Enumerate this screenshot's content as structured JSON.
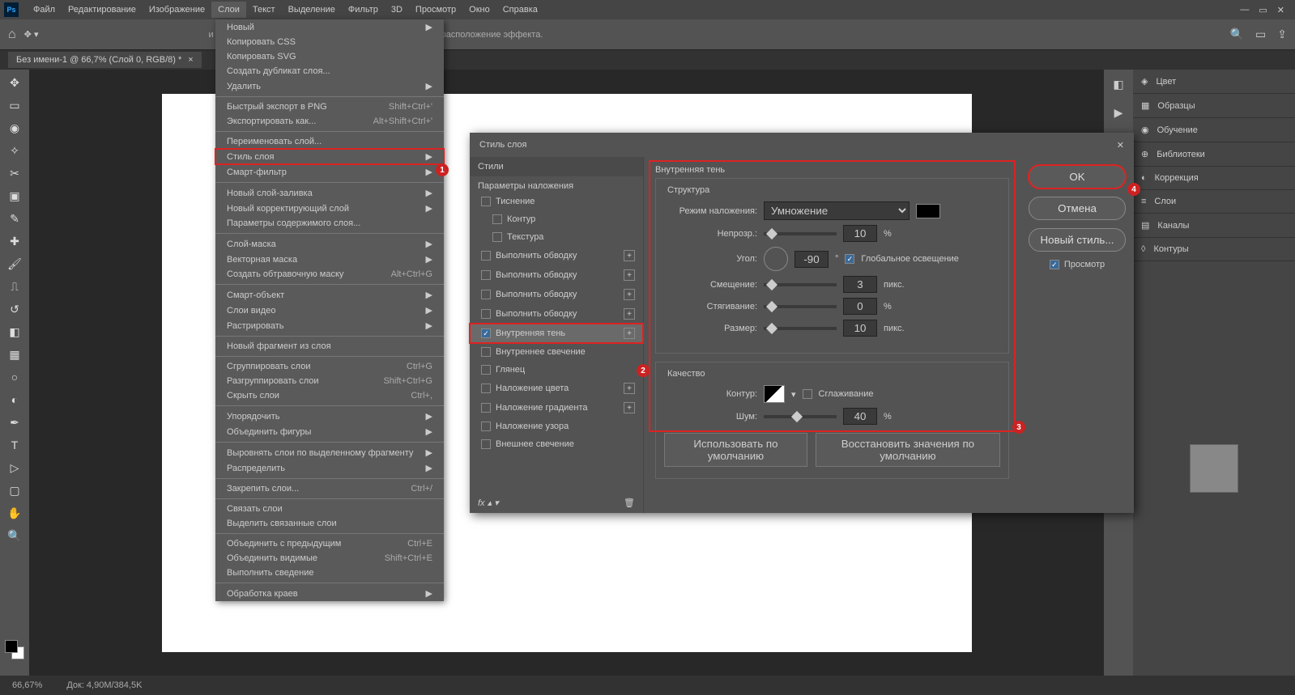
{
  "menubar": {
    "items": [
      "Файл",
      "Редактирование",
      "Изображение",
      "Слои",
      "Текст",
      "Выделение",
      "Фильтр",
      "3D",
      "Просмотр",
      "Окно",
      "Справка"
    ],
    "active_index": 3
  },
  "optionsbar": {
    "hint_tail": "и перетаскивайте ее указатель, чтобы скорректировать расположение эффекта."
  },
  "doc_tab": {
    "title": "Без имени-1 @ 66,7% (Слой 0, RGB/8) *"
  },
  "dropdown": {
    "groups": [
      [
        {
          "l": "Новый",
          "a": "▶"
        },
        {
          "l": "Копировать CSS"
        },
        {
          "l": "Копировать SVG"
        },
        {
          "l": "Создать дубликат слоя..."
        },
        {
          "l": "Удалить",
          "a": "▶"
        }
      ],
      [
        {
          "l": "Быстрый экспорт в PNG",
          "s": "Shift+Ctrl+'"
        },
        {
          "l": "Экспортировать как...",
          "s": "Alt+Shift+Ctrl+'"
        }
      ],
      [
        {
          "l": "Переименовать слой..."
        },
        {
          "l": "Стиль слоя",
          "a": "▶",
          "hl": true
        },
        {
          "l": "Смарт-фильтр",
          "a": "▶"
        }
      ],
      [
        {
          "l": "Новый слой-заливка",
          "a": "▶"
        },
        {
          "l": "Новый корректирующий слой",
          "a": "▶"
        },
        {
          "l": "Параметры содержимого слоя..."
        }
      ],
      [
        {
          "l": "Слой-маска",
          "a": "▶"
        },
        {
          "l": "Векторная маска",
          "a": "▶"
        },
        {
          "l": "Создать обтравочную маску",
          "s": "Alt+Ctrl+G"
        }
      ],
      [
        {
          "l": "Смарт-объект",
          "a": "▶"
        },
        {
          "l": "Слои видео",
          "a": "▶"
        },
        {
          "l": "Растрировать",
          "a": "▶"
        }
      ],
      [
        {
          "l": "Новый фрагмент из слоя"
        }
      ],
      [
        {
          "l": "Сгруппировать слои",
          "s": "Ctrl+G"
        },
        {
          "l": "Разгруппировать слои",
          "s": "Shift+Ctrl+G"
        },
        {
          "l": "Скрыть слои",
          "s": "Ctrl+,"
        }
      ],
      [
        {
          "l": "Упорядочить",
          "a": "▶"
        },
        {
          "l": "Объединить фигуры",
          "a": "▶"
        }
      ],
      [
        {
          "l": "Выровнять слои по выделенному фрагменту",
          "a": "▶"
        },
        {
          "l": "Распределить",
          "a": "▶"
        }
      ],
      [
        {
          "l": "Закрепить слои...",
          "s": "Ctrl+/"
        }
      ],
      [
        {
          "l": "Связать слои"
        },
        {
          "l": "Выделить связанные слои"
        }
      ],
      [
        {
          "l": "Объединить с предыдущим",
          "s": "Ctrl+E"
        },
        {
          "l": "Объединить видимые",
          "s": "Shift+Ctrl+E"
        },
        {
          "l": "Выполнить сведение"
        }
      ],
      [
        {
          "l": "Обработка краев",
          "a": "▶"
        }
      ]
    ]
  },
  "dialog": {
    "title": "Стиль слоя",
    "styles_hdr": "Стили",
    "blend_opts": "Параметры наложения",
    "effects": [
      {
        "l": "Тиснение"
      },
      {
        "l": "Контур",
        "indent": true
      },
      {
        "l": "Текстура",
        "indent": true
      },
      {
        "l": "Выполнить обводку",
        "plus": true
      },
      {
        "l": "Выполнить обводку",
        "plus": true
      },
      {
        "l": "Выполнить обводку",
        "plus": true
      },
      {
        "l": "Выполнить обводку",
        "plus": true
      },
      {
        "l": "Внутренняя тень",
        "plus": true,
        "checked": true,
        "sel": true
      },
      {
        "l": "Внутреннее свечение"
      },
      {
        "l": "Глянец"
      },
      {
        "l": "Наложение цвета",
        "plus": true
      },
      {
        "l": "Наложение градиента",
        "plus": true
      },
      {
        "l": "Наложение узора"
      },
      {
        "l": "Внешнее свечение"
      }
    ],
    "section_name": "Внутренняя тень",
    "structure_title": "Структура",
    "quality_title": "Качество",
    "labels": {
      "blend_mode": "Режим наложения:",
      "opacity": "Непрозр.:",
      "angle": "Угол:",
      "global_light": "Глобальное освещение",
      "distance": "Смещение:",
      "choke": "Стягивание:",
      "size": "Размер:",
      "contour": "Контур:",
      "antialias": "Сглаживание",
      "noise": "Шум:",
      "pct": "%",
      "px": "пикс.",
      "deg": "°"
    },
    "values": {
      "blend_mode": "Умножение",
      "opacity": "10",
      "angle": "-90",
      "distance": "3",
      "choke": "0",
      "size": "10",
      "noise": "40"
    },
    "btn_default": "Использовать по умолчанию",
    "btn_reset": "Восстановить значения по умолчанию",
    "btn_ok": "OK",
    "btn_cancel": "Отмена",
    "btn_newstyle": "Новый стиль...",
    "preview_label": "Просмотр"
  },
  "right_panels": [
    "Цвет",
    "Образцы",
    "Обучение",
    "Библиотеки",
    "Коррекция",
    "Слои",
    "Каналы",
    "Контуры"
  ],
  "status": {
    "zoom": "66,67%",
    "docsize": "Док: 4,90M/384,5K"
  },
  "badges": {
    "b1": "1",
    "b2": "2",
    "b3": "3",
    "b4": "4"
  }
}
